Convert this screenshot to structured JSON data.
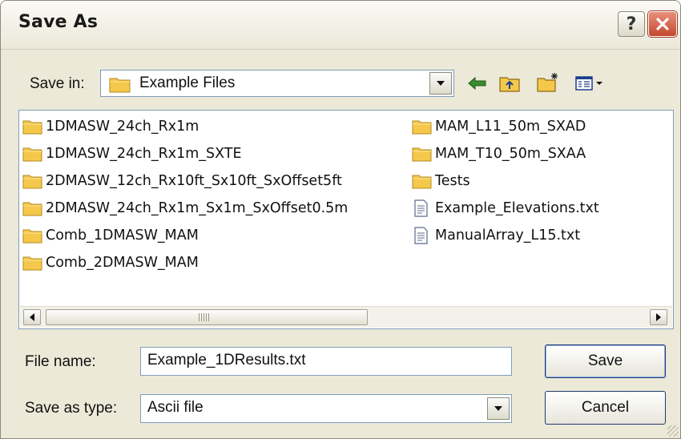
{
  "window": {
    "title": "Save As",
    "help_glyph": "?"
  },
  "save_in": {
    "label": "Save in:",
    "value": "Example Files"
  },
  "toolbar": [
    {
      "name": "back-button",
      "icon": "back-arrow-icon"
    },
    {
      "name": "up-folder-button",
      "icon": "up-folder-icon"
    },
    {
      "name": "new-folder-button",
      "icon": "new-folder-icon"
    },
    {
      "name": "view-menu-button",
      "icon": "view-menu-icon"
    }
  ],
  "files": {
    "column1": [
      {
        "name": "1DMASW_24ch_Rx1m",
        "type": "folder"
      },
      {
        "name": "1DMASW_24ch_Rx1m_SXTE",
        "type": "folder"
      },
      {
        "name": "2DMASW_12ch_Rx10ft_Sx10ft_SxOffset5ft",
        "type": "folder"
      },
      {
        "name": "2DMASW_24ch_Rx1m_Sx1m_SxOffset0.5m",
        "type": "folder"
      },
      {
        "name": "Comb_1DMASW_MAM",
        "type": "folder"
      },
      {
        "name": "Comb_2DMASW_MAM",
        "type": "folder"
      }
    ],
    "column2": [
      {
        "name": "MAM_L11_50m_SXAD",
        "type": "folder"
      },
      {
        "name": "MAM_T10_50m_SXAA",
        "type": "folder"
      },
      {
        "name": "Tests",
        "type": "folder"
      },
      {
        "name": "Example_Elevations.txt",
        "type": "text-file"
      },
      {
        "name": "ManualArray_L15.txt",
        "type": "text-file"
      }
    ]
  },
  "scrollbar": {
    "position_fraction": 0.0
  },
  "file_name": {
    "label": "File name:",
    "value": "Example_1DResults.txt"
  },
  "save_as_type": {
    "label": "Save as type:",
    "value": "Ascii file"
  },
  "buttons": {
    "save": "Save",
    "cancel": "Cancel"
  },
  "colors": {
    "folder": "#f5c84c",
    "close_button": "#d0543a",
    "field_border": "#7f9db9"
  }
}
